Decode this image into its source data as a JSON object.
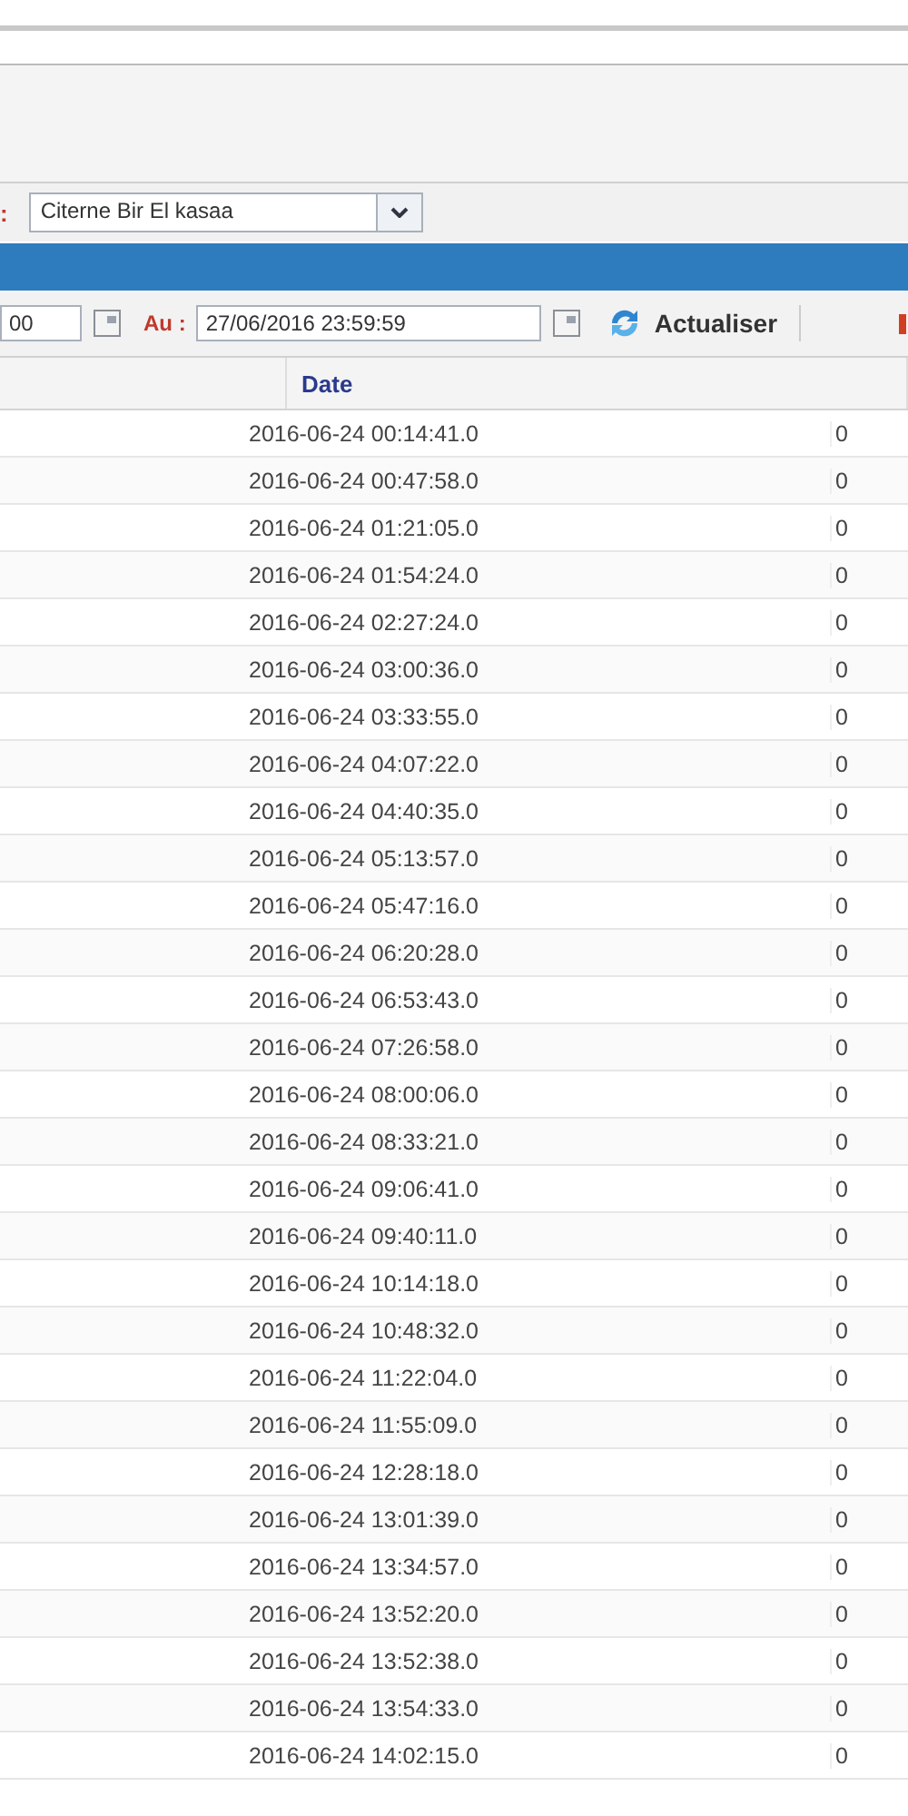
{
  "filter_bar": {
    "label": ":",
    "select": {
      "value": "Citerne Bir El kasaa"
    }
  },
  "date_bar": {
    "from_field": {
      "value": "00"
    },
    "to_label": "Au :",
    "to_field": {
      "value": "27/06/2016 23:59:59"
    },
    "refresh_button": "Actualiser"
  },
  "table": {
    "columns": [
      "Date"
    ],
    "rows": [
      {
        "date": "2016-06-24 00:14:41.0",
        "column_3": "0"
      },
      {
        "date": "2016-06-24 00:47:58.0",
        "column_3": "0"
      },
      {
        "date": "2016-06-24 01:21:05.0",
        "column_3": "0"
      },
      {
        "date": "2016-06-24 01:54:24.0",
        "column_3": "0"
      },
      {
        "date": "2016-06-24 02:27:24.0",
        "column_3": "0"
      },
      {
        "date": "2016-06-24 03:00:36.0",
        "column_3": "0"
      },
      {
        "date": "2016-06-24 03:33:55.0",
        "column_3": "0"
      },
      {
        "date": "2016-06-24 04:07:22.0",
        "column_3": "0"
      },
      {
        "date": "2016-06-24 04:40:35.0",
        "column_3": "0"
      },
      {
        "date": "2016-06-24 05:13:57.0",
        "column_3": "0"
      },
      {
        "date": "2016-06-24 05:47:16.0",
        "column_3": "0"
      },
      {
        "date": "2016-06-24 06:20:28.0",
        "column_3": "0"
      },
      {
        "date": "2016-06-24 06:53:43.0",
        "column_3": "0"
      },
      {
        "date": "2016-06-24 07:26:58.0",
        "column_3": "0"
      },
      {
        "date": "2016-06-24 08:00:06.0",
        "column_3": "0"
      },
      {
        "date": "2016-06-24 08:33:21.0",
        "column_3": "0"
      },
      {
        "date": "2016-06-24 09:06:41.0",
        "column_3": "0"
      },
      {
        "date": "2016-06-24 09:40:11.0",
        "column_3": "0"
      },
      {
        "date": "2016-06-24 10:14:18.0",
        "column_3": "0"
      },
      {
        "date": "2016-06-24 10:48:32.0",
        "column_3": "0"
      },
      {
        "date": "2016-06-24 11:22:04.0",
        "column_3": "0"
      },
      {
        "date": "2016-06-24 11:55:09.0",
        "column_3": "0"
      },
      {
        "date": "2016-06-24 12:28:18.0",
        "column_3": "0"
      },
      {
        "date": "2016-06-24 13:01:39.0",
        "column_3": "0"
      },
      {
        "date": "2016-06-24 13:34:57.0",
        "column_3": "0"
      },
      {
        "date": "2016-06-24 13:52:20.0",
        "column_3": "0"
      },
      {
        "date": "2016-06-24 13:52:38.0",
        "column_3": "0"
      },
      {
        "date": "2016-06-24 13:54:33.0",
        "column_3": "0"
      },
      {
        "date": "2016-06-24 14:02:15.0",
        "column_3": "0"
      }
    ]
  }
}
